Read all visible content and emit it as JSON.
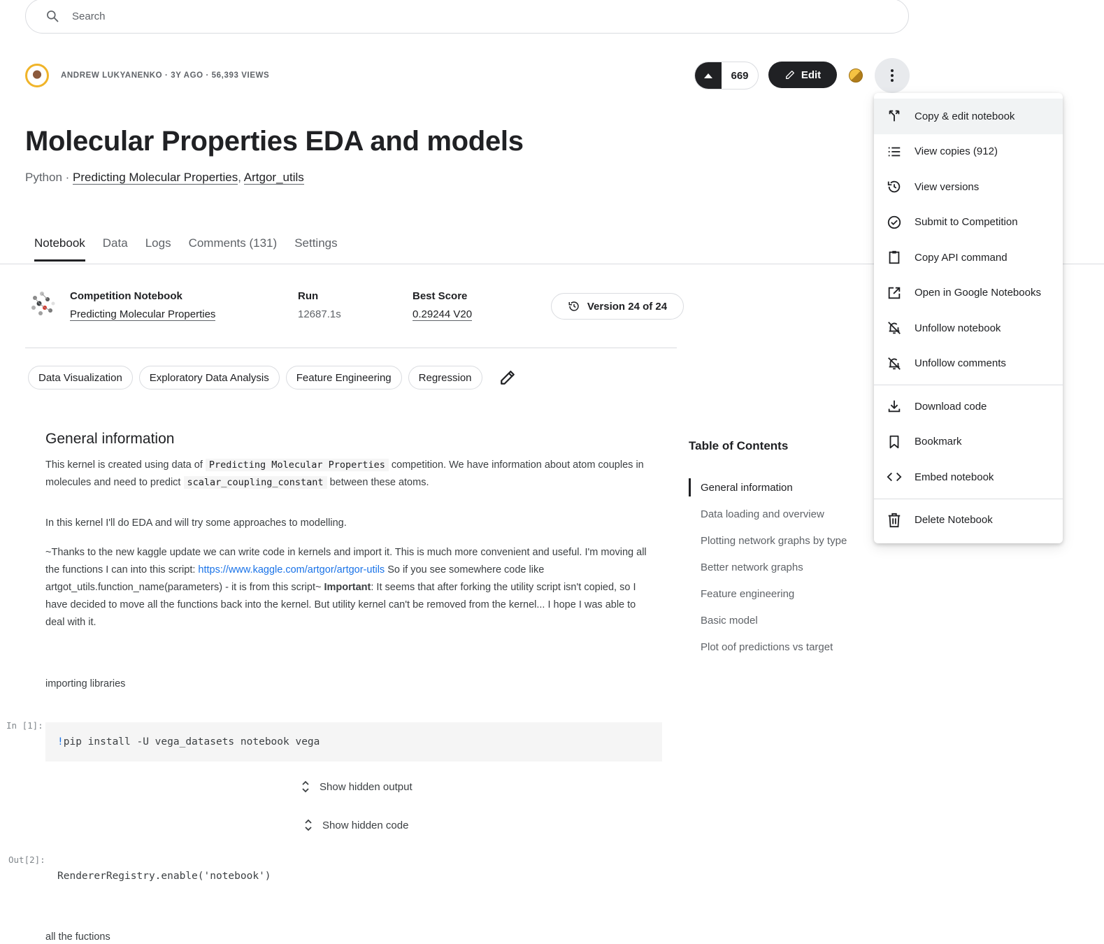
{
  "search": {
    "placeholder": "Search"
  },
  "header": {
    "meta": "ANDREW LUKYANENKO · 3Y AGO · 56,393 VIEWS",
    "votes": "669",
    "edit_label": "Edit"
  },
  "notebook_title": "Molecular Properties EDA and models",
  "subtitle": {
    "prefix": "Python · ",
    "link1": "Predicting Molecular Properties",
    "sep": ", ",
    "link2": "Artgor_utils"
  },
  "tabs": [
    "Notebook",
    "Data",
    "Logs",
    "Comments (131)",
    "Settings"
  ],
  "info": {
    "comp_label": "Competition Notebook",
    "comp_value": "Predicting Molecular Properties",
    "run_label": "Run",
    "run_value": "12687.1s",
    "score_label": "Best Score",
    "score_value": "0.29244 V20",
    "version": "Version 24 of 24"
  },
  "tags": [
    "Data Visualization",
    "Exploratory Data Analysis",
    "Feature Engineering",
    "Regression"
  ],
  "content": {
    "h_general": "General information",
    "p1_a": "This kernel is created using data of ",
    "p1_code1": "Predicting Molecular Properties",
    "p1_b": " competition. We have information about atom couples in molecules and need to predict ",
    "p1_code2": "scalar_coupling_constant",
    "p1_c": " between these atoms.",
    "p2": "In this kernel I'll do EDA and will try some approaches to modelling.",
    "p3_a": "~Thanks to the new kaggle update we can write code in kernels and import it. This is much more convenient and useful. I'm moving all the functions I can into this script: ",
    "p3_link": "https://www.kaggle.com/artgor/artgor-utils",
    "p3_b": " So if you see somewhere code like artgot_utils.function_name(parameters) - it is from this script~ ",
    "p3_bold": "Important",
    "p3_c": ": It seems that after forking the utility script isn't copied, so I have decided to move all the functions back into the kernel. But utility kernel can't be removed from the kernel... I hope I was able to deal with it.",
    "p4": "importing libraries",
    "prompt_in1": "In [1]:",
    "code1_bang": "!",
    "code1": "pip install -U vega_datasets notebook vega",
    "show_output": "Show hidden output",
    "show_code": "Show hidden code",
    "prompt_out2": "Out[2]:",
    "out2": "RendererRegistry.enable('notebook')",
    "p5": "all the fuctions"
  },
  "toc": {
    "title": "Table of Contents",
    "items": [
      "General information",
      "Data loading and overview",
      "Plotting network graphs by type",
      "Better network graphs",
      "Feature engineering",
      "Basic model",
      "Plot oof predictions vs target"
    ]
  },
  "menu": {
    "items": [
      {
        "label": "Copy & edit notebook",
        "icon": "fork-icon"
      },
      {
        "label": "View copies (912)",
        "icon": "list-icon"
      },
      {
        "label": "View versions",
        "icon": "history-icon"
      },
      {
        "label": "Submit to Competition",
        "icon": "check-circle-icon"
      },
      {
        "label": "Copy API command",
        "icon": "clipboard-icon"
      },
      {
        "label": "Open in Google Notebooks",
        "icon": "open-external-icon"
      },
      {
        "label": "Unfollow notebook",
        "icon": "bell-off-icon"
      },
      {
        "label": "Unfollow comments",
        "icon": "bell-off-icon"
      },
      {
        "label": "Download code",
        "icon": "download-icon"
      },
      {
        "label": "Bookmark",
        "icon": "bookmark-icon"
      },
      {
        "label": "Embed notebook",
        "icon": "code-icon"
      },
      {
        "label": "Delete Notebook",
        "icon": "trash-icon"
      }
    ]
  },
  "colors": {
    "dark": "#202124",
    "link": "#1a73e8",
    "muted": "#5f6368",
    "border": "#dadce0"
  }
}
